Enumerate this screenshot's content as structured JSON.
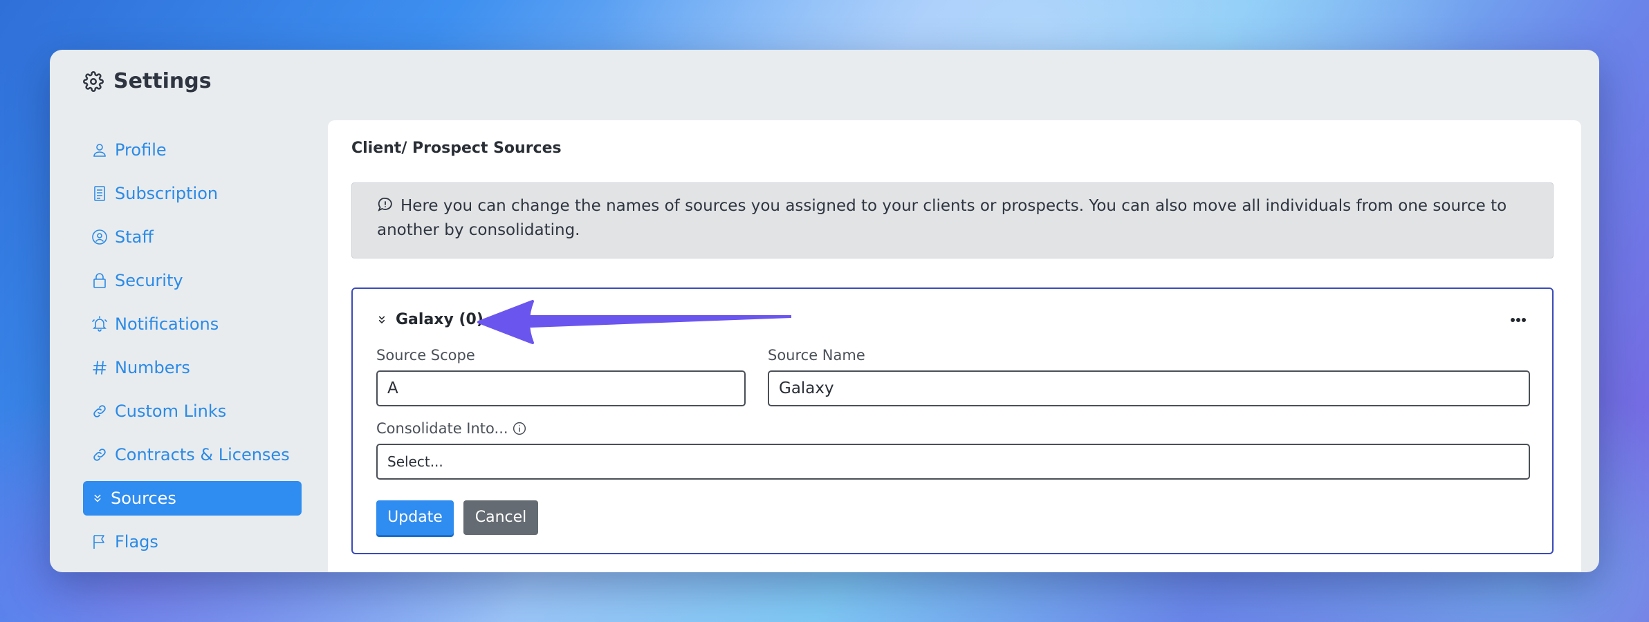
{
  "window": {
    "title": "Settings"
  },
  "sidebar": {
    "items": [
      {
        "label": "Profile",
        "icon": "user-icon"
      },
      {
        "label": "Subscription",
        "icon": "receipt-icon"
      },
      {
        "label": "Staff",
        "icon": "user-circle-icon"
      },
      {
        "label": "Security",
        "icon": "lock-icon"
      },
      {
        "label": "Notifications",
        "icon": "bell-icon"
      },
      {
        "label": "Numbers",
        "icon": "hash-icon"
      },
      {
        "label": "Custom Links",
        "icon": "link-icon"
      },
      {
        "label": "Contracts & Licenses",
        "icon": "link-icon"
      },
      {
        "label": "Sources",
        "icon": "chevrons-down-icon",
        "active": true
      },
      {
        "label": "Flags",
        "icon": "flag-icon"
      }
    ]
  },
  "main": {
    "title": "Client/ Prospect Sources",
    "info_text": "Here you can change the names of sources you assigned to your clients or prospects. You can also move all individuals from one source to another by consolidating.",
    "source": {
      "title": "Galaxy (0)",
      "scope_label": "Source Scope",
      "scope_value": "A",
      "name_label": "Source Name",
      "name_value": "Galaxy",
      "consolidate_label": "Consolidate Into...",
      "consolidate_placeholder": "Select...",
      "update_label": "Update",
      "cancel_label": "Cancel"
    }
  },
  "colors": {
    "accent": "#2f8cf0",
    "panel_border": "#3a4bb8",
    "arrow": "#6b55ef",
    "link": "#2b8ae6"
  }
}
